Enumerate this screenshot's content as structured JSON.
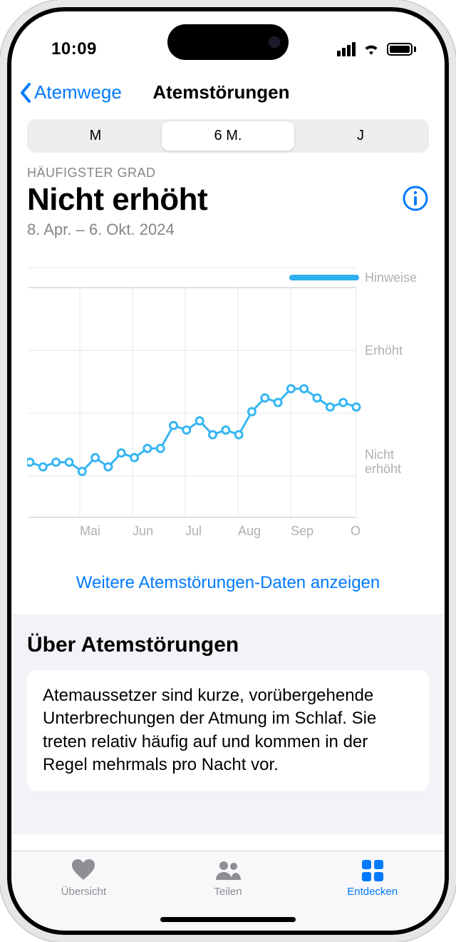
{
  "status": {
    "time": "10:09"
  },
  "nav": {
    "back_label": "Atemwege",
    "title": "Atemstörungen"
  },
  "segments": {
    "month": "M",
    "six_month": "6 M.",
    "year": "J"
  },
  "summary": {
    "label": "HÄUFIGSTER GRAD",
    "value": "Nicht erhöht",
    "range": "8. Apr. – 6. Okt. 2024"
  },
  "chart": {
    "y_labels": {
      "hinweise": "Hinweise",
      "erhoht": "Erhöht",
      "nicht_erhoht": "Nicht\nerhöht"
    },
    "x_labels": [
      "Mai",
      "Jun",
      "Jul",
      "Aug",
      "Sep",
      "O"
    ]
  },
  "more_link": "Weitere Atemstörungen-Daten anzeigen",
  "about": {
    "title": "Über Atemstörungen",
    "body": "Atemaussetzer sind kurze, vorübergehende Unterbrechungen der Atmung im Schlaf. Sie treten relativ häufig auf und kommen in der Regel mehrmals pro Nacht vor."
  },
  "tabs": {
    "overview": "Übersicht",
    "share": "Teilen",
    "discover": "Entdecken"
  },
  "colors": {
    "accent": "#007aff",
    "chart_line": "#37b6f2"
  },
  "chart_data": {
    "type": "line",
    "title": "Atemstörungen",
    "xlabel": "",
    "ylabel": "Grad",
    "ylim": [
      0,
      100
    ],
    "y_categories": [
      "Nicht erhöht",
      "Erhöht",
      "Hinweise"
    ],
    "x": [
      0,
      1,
      2,
      3,
      4,
      5,
      6,
      7,
      8,
      9,
      10,
      11,
      12,
      13,
      14,
      15,
      16,
      17,
      18,
      19,
      20,
      21,
      22,
      23,
      24,
      25
    ],
    "x_range_label": "8. Apr. – 6. Okt. 2024",
    "x_month_markers": {
      "4": "Mai",
      "8": "Jun",
      "12": "Jul",
      "16": "Aug",
      "20": "Sep",
      "25": "O"
    },
    "values": [
      24,
      22,
      24,
      24,
      20,
      26,
      22,
      28,
      26,
      30,
      30,
      40,
      38,
      42,
      36,
      38,
      36,
      46,
      52,
      50,
      56,
      56,
      52,
      48,
      50,
      48
    ],
    "annotations": [
      {
        "type": "legend-bar",
        "position": "top-right",
        "label": "Hinweise"
      }
    ]
  }
}
